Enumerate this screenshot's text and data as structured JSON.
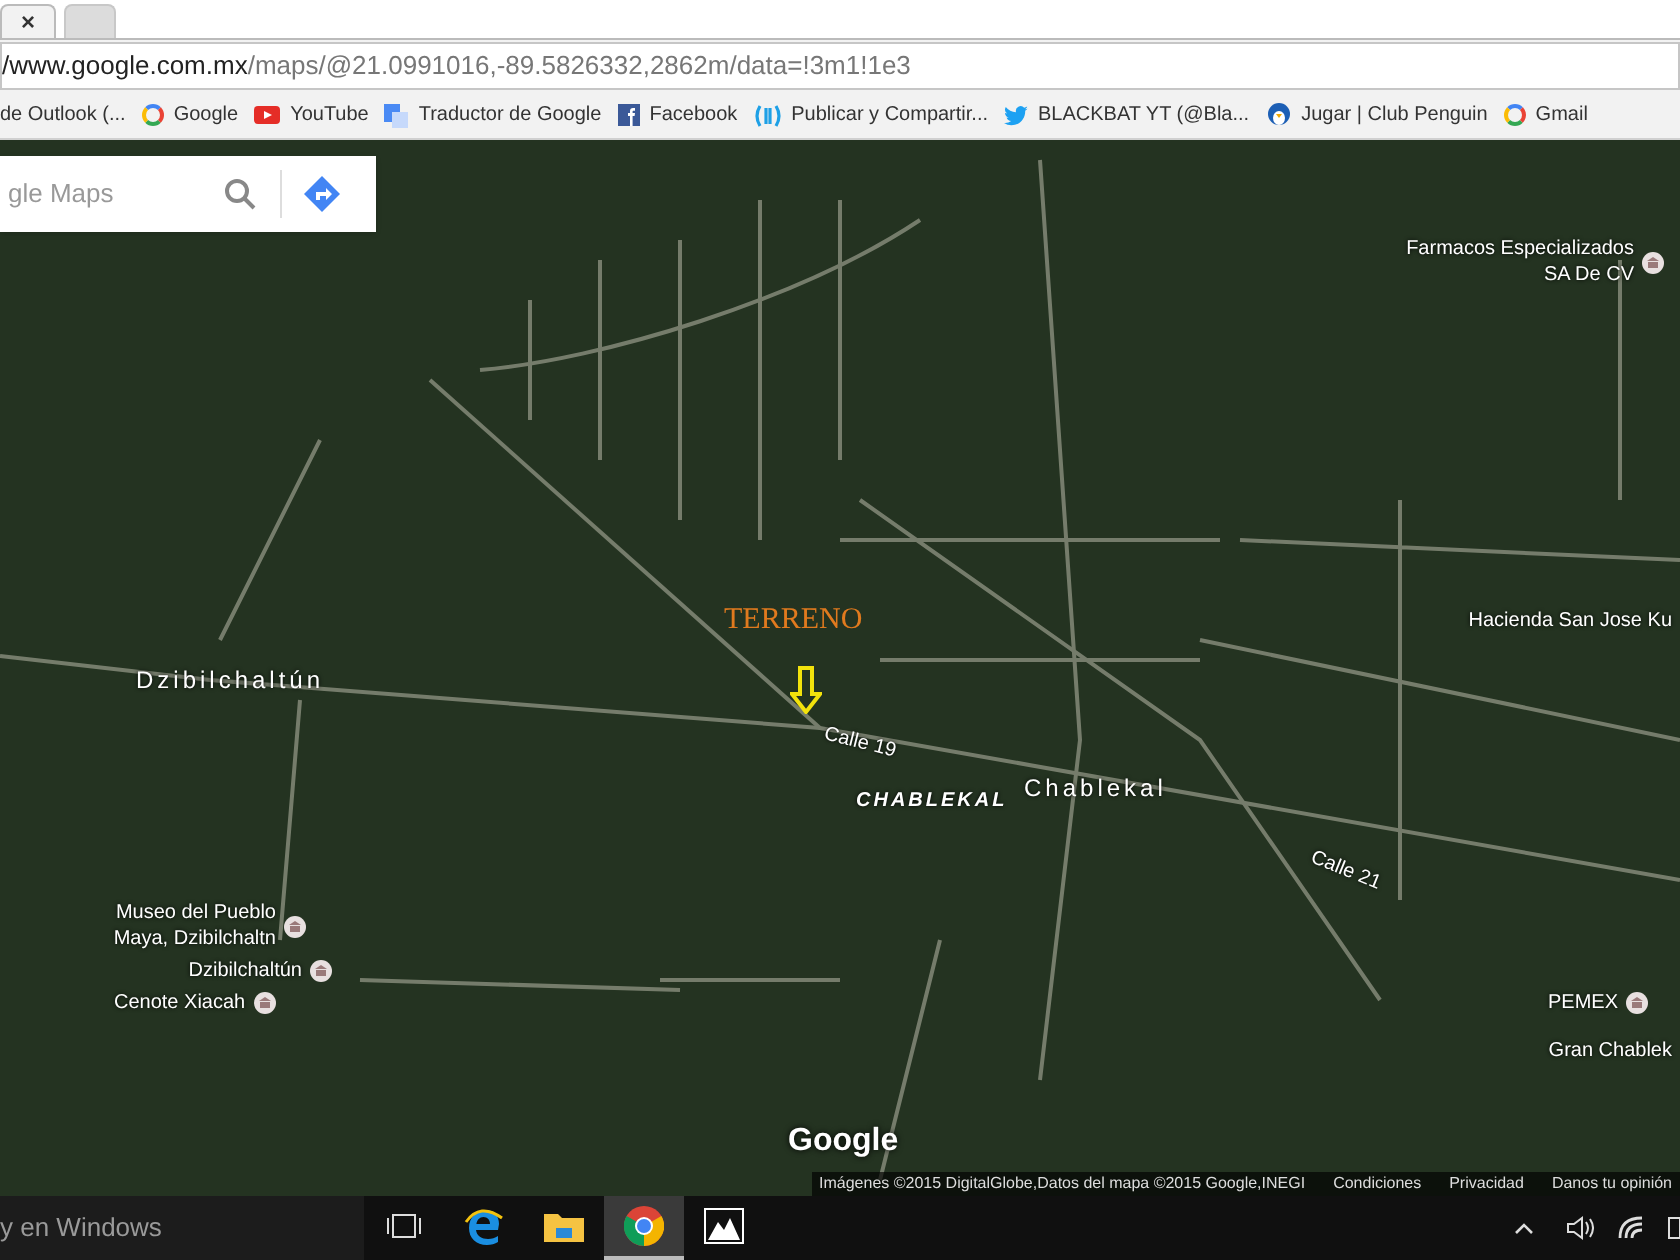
{
  "browser": {
    "tabs": [
      {
        "close": "×",
        "selected": true
      },
      {
        "selected": false
      }
    ],
    "address": {
      "host": "/www.google.com.mx",
      "path": "/maps/@21.0991016,-89.5826332,2862m/data=!3m1!1e3"
    },
    "bookmarks": [
      {
        "kind": "outlook",
        "label": "de Outlook (..."
      },
      {
        "kind": "google",
        "label": "Google"
      },
      {
        "kind": "youtube",
        "label": "YouTube"
      },
      {
        "kind": "translate",
        "label": "Traductor de Google"
      },
      {
        "kind": "facebook",
        "label": "Facebook"
      },
      {
        "kind": "share",
        "label": "Publicar y Compartir..."
      },
      {
        "kind": "twitter",
        "label": "BLACKBAT YT (@Bla..."
      },
      {
        "kind": "penguin",
        "label": "Jugar | Club Penguin"
      },
      {
        "kind": "google",
        "label": "Gmail"
      }
    ]
  },
  "map": {
    "search": {
      "placeholder": "gle Maps"
    },
    "labels": [
      {
        "kind": "poi",
        "text": "Farmacos Especializados\nSA De CV"
      },
      {
        "kind": "annotation",
        "text": "TERRENO"
      },
      {
        "kind": "place",
        "text": "Hacienda San Jose Ku"
      },
      {
        "kind": "town",
        "text": "Dzibilchaltún"
      },
      {
        "kind": "road",
        "text": "Calle 19"
      },
      {
        "kind": "district",
        "text": "CHABLEKAL"
      },
      {
        "kind": "town",
        "text": "Chablekal"
      },
      {
        "kind": "road",
        "text": "Calle 21"
      },
      {
        "kind": "poi",
        "text": "Museo del Pueblo\nMaya, Dzibilchaltn"
      },
      {
        "kind": "poi",
        "text": "Dzibilchaltún"
      },
      {
        "kind": "poi",
        "text": "Cenote Xiacah"
      },
      {
        "kind": "poi",
        "text": "PEMEX"
      },
      {
        "kind": "place",
        "text": "Gran Chablek"
      }
    ],
    "logo": "Google",
    "footer": [
      "Imágenes ©2015 DigitalGlobe,Datos del mapa ©2015 Google,INEGI",
      "Condiciones",
      "Privacidad",
      "Danos tu opinión"
    ]
  },
  "taskbar": {
    "search": "y en Windows",
    "apps": [
      {
        "kind": "taskview",
        "selected": false
      },
      {
        "kind": "edge",
        "selected": false
      },
      {
        "kind": "explorer",
        "selected": false
      },
      {
        "kind": "chrome",
        "selected": true
      },
      {
        "kind": "photos",
        "selected": false
      }
    ]
  }
}
